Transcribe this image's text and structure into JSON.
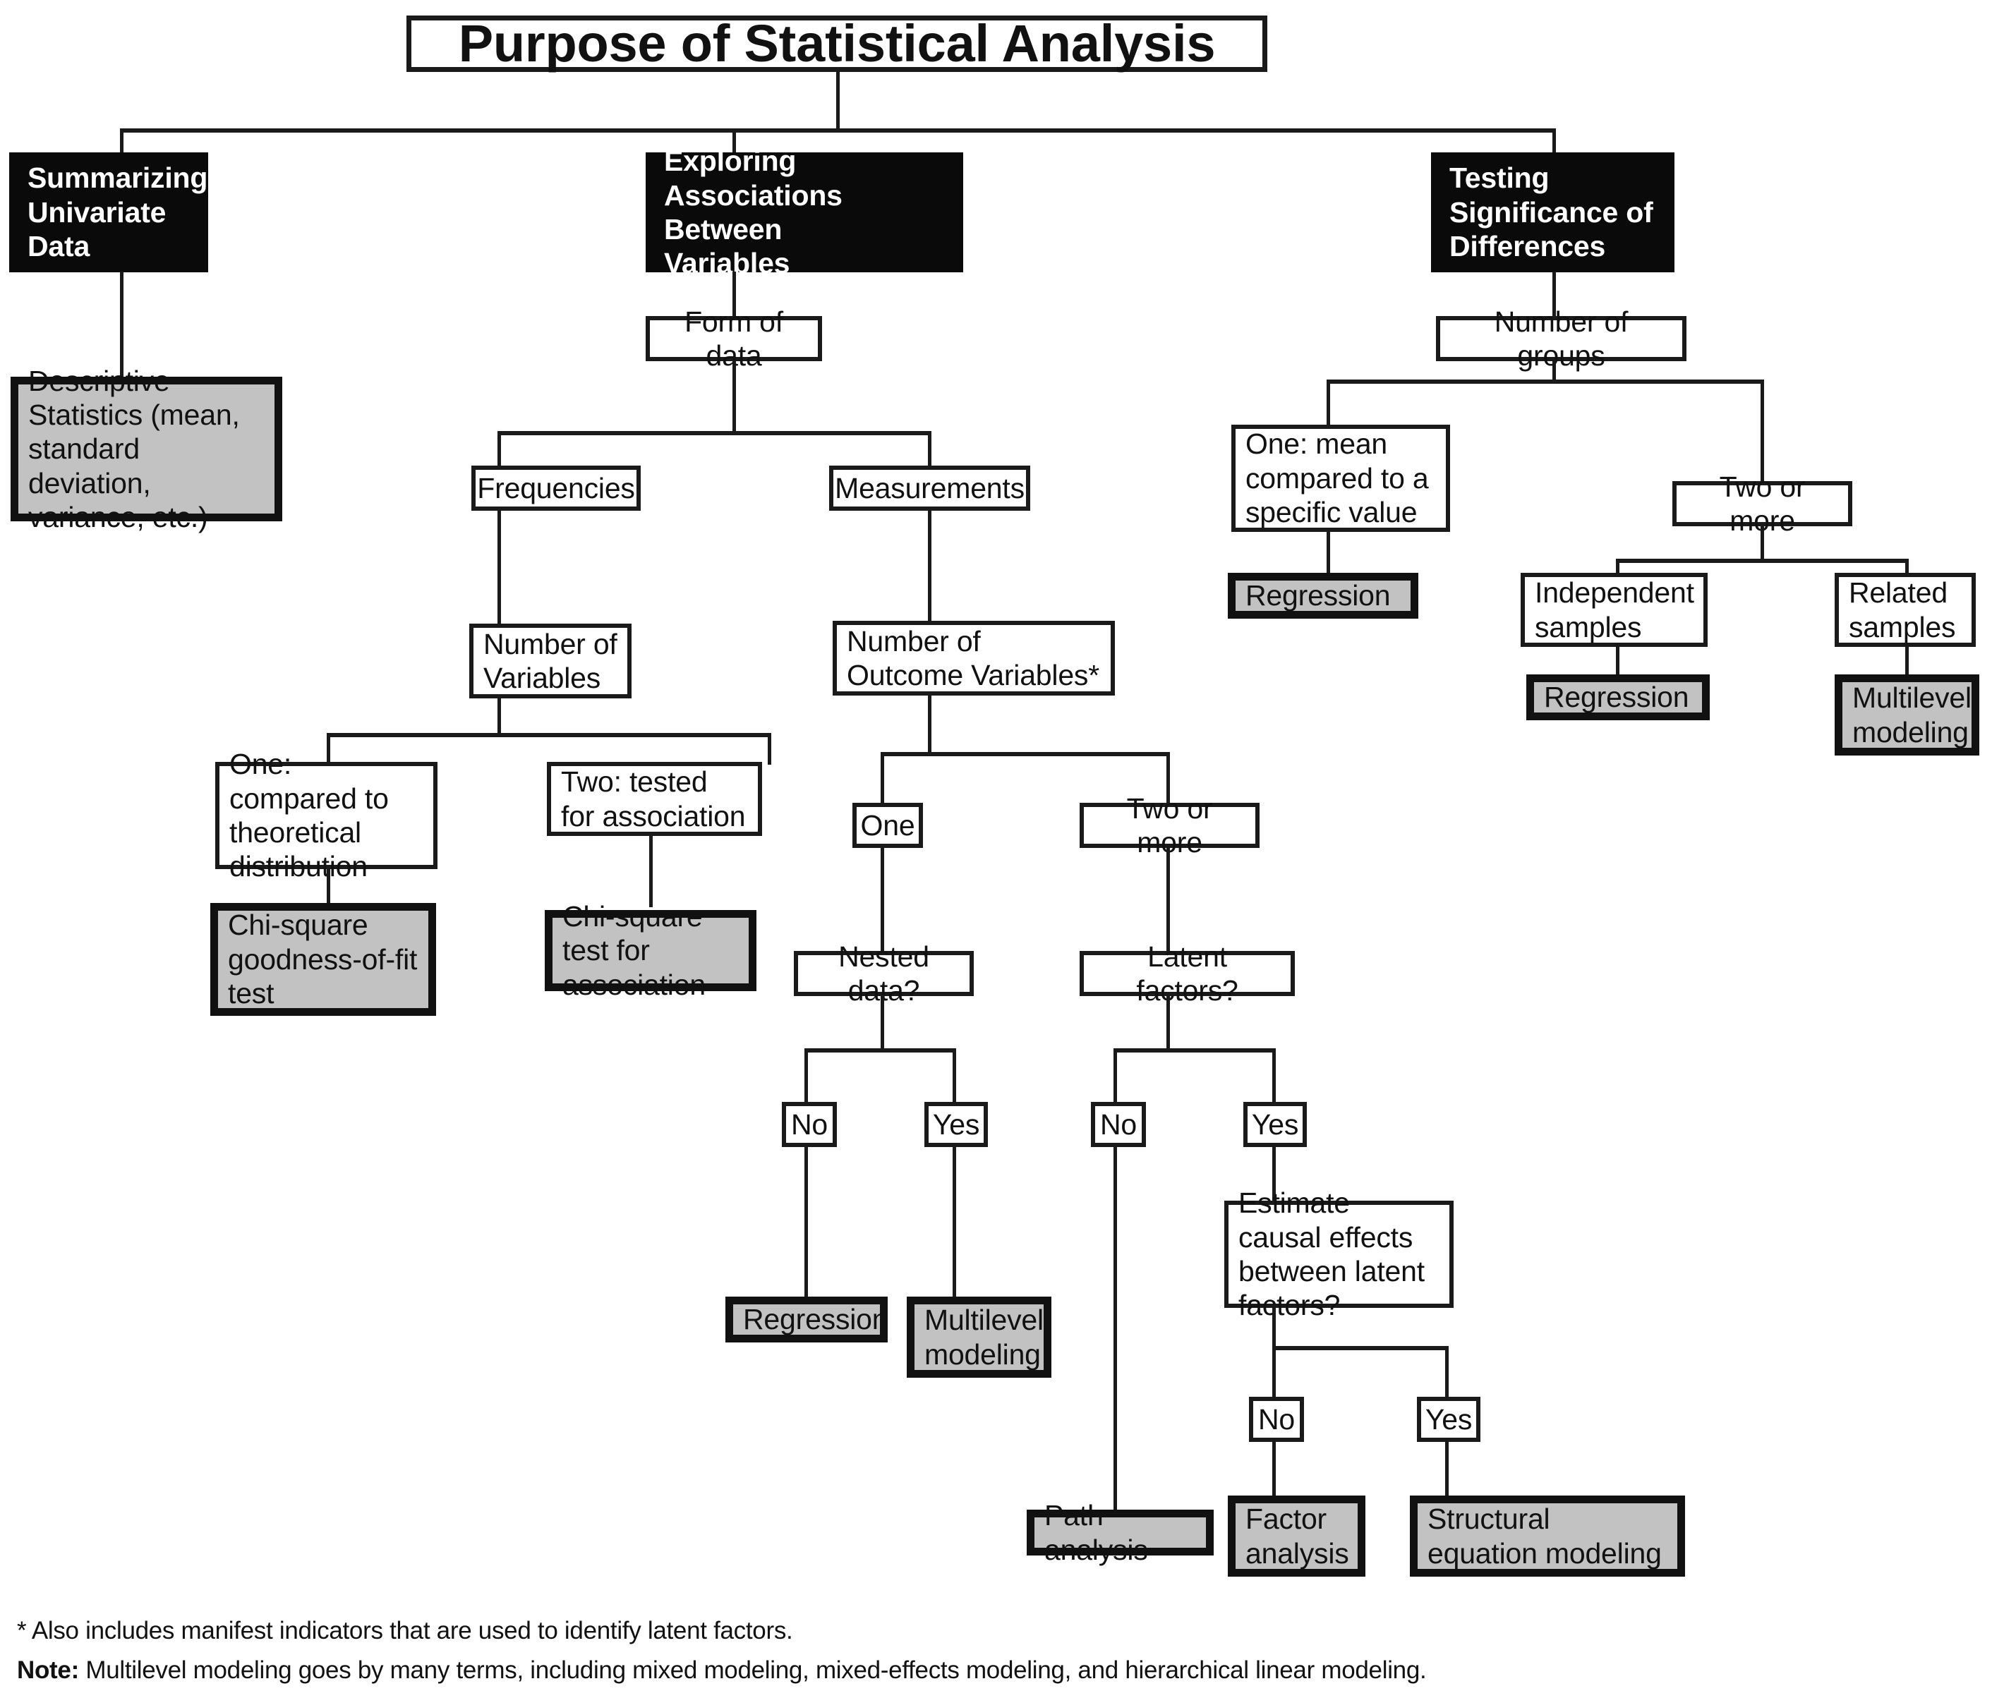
{
  "title": "Purpose of Statistical Analysis",
  "branches": {
    "summarizing": {
      "header": "Summarizing Univariate Data",
      "header_lines": [
        "Summarizing",
        "Univariate",
        "Data"
      ],
      "result": "Descriptive Statistics (mean, standard deviation, variance, etc.)"
    },
    "exploring": {
      "header": "Exploring Associations Between Variables",
      "header_lines": [
        "Exploring",
        "Associations Between",
        "Variables"
      ],
      "form_of_data": "Form of data",
      "frequencies": "Frequencies",
      "measurements": "Measurements",
      "number_of_variables": "Number of Variables",
      "one_compared": "One: compared to theoretical distribution",
      "two_tested": "Two: tested for association",
      "chi_square_gof": "Chi-square goodness-of-fit test",
      "chi_square_assoc": "Chi-square test for association",
      "number_of_outcome_variables": "Number of Outcome Variables*",
      "one": "One",
      "two_or_more": "Two or more",
      "nested_data": "Nested data?",
      "latent_factors": "Latent factors?",
      "nested_no": "No",
      "nested_yes": "Yes",
      "latent_no": "No",
      "latent_yes": "Yes",
      "regression": "Regression",
      "multilevel_modeling": "Multilevel modeling",
      "estimate_causal": "Estimate causal effects between latent factors?",
      "causal_no": "No",
      "causal_yes": "Yes",
      "path_analysis": "Path analysis",
      "factor_analysis": "Factor analysis",
      "sem": "Structural equation modeling"
    },
    "testing": {
      "header": "Testing Significance of Differences",
      "header_lines": [
        "Testing",
        "Significance of",
        "Differences"
      ],
      "number_of_groups": "Number of groups",
      "one_mean": "One: mean compared to a specific value",
      "two_or_more": "Two or more",
      "independent_samples": "Independent samples",
      "related_samples": "Related samples",
      "regression_one": "Regression",
      "regression_indep": "Regression",
      "multilevel_modeling": "Multilevel modeling"
    }
  },
  "footnotes": {
    "asterisk": "* Also includes manifest indicators that are used to identify latent factors.",
    "note_label": "Note:",
    "note_text": " Multilevel modeling goes by many terms, including mixed modeling, mixed-effects modeling, and hierarchical linear modeling."
  },
  "colors": {
    "line": "#1a1a1a",
    "black_box": "#0a0a0a",
    "gray_box": "#c2c2c2",
    "text": "#111111",
    "background": "#ffffff"
  }
}
